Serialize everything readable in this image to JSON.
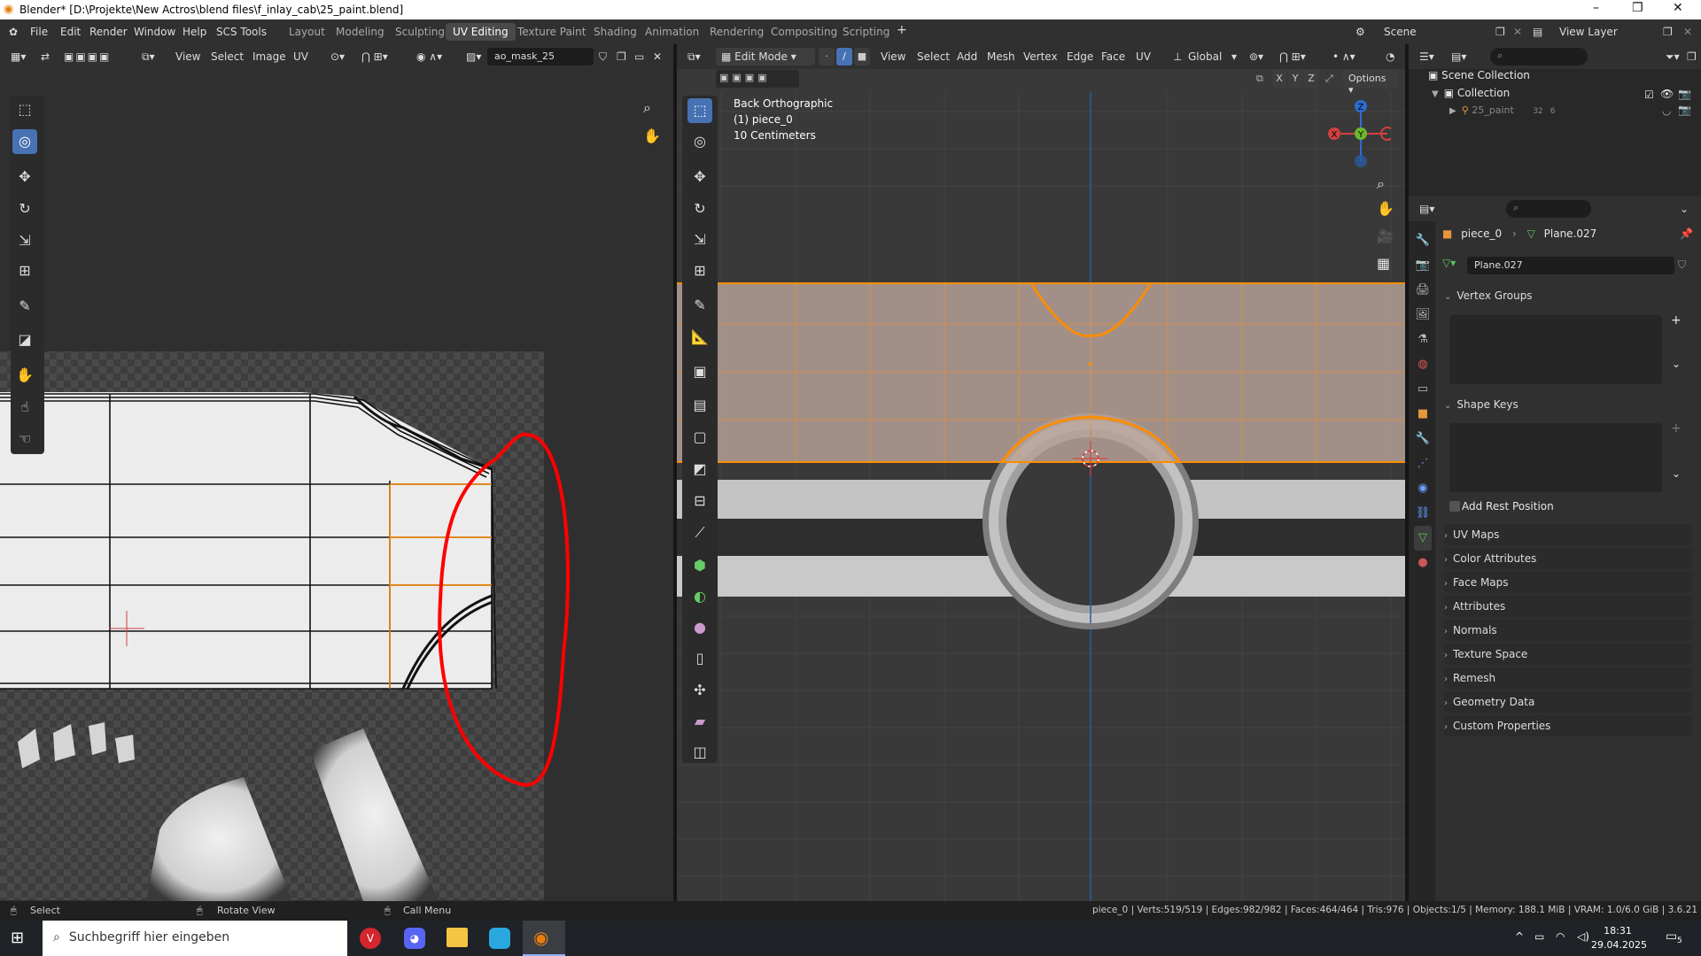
{
  "window": {
    "title": "Blender* [D:\\Projekte\\New Actros\\blend files\\f_inlay_cab\\25_paint.blend]"
  },
  "menu": [
    "File",
    "Edit",
    "Render",
    "Window",
    "Help",
    "SCS Tools"
  ],
  "workspaces": [
    "Layout",
    "Modeling",
    "Sculpting",
    "UV Editing",
    "Texture Paint",
    "Shading",
    "Animation",
    "Rendering",
    "Compositing",
    "Scripting"
  ],
  "active_workspace": "UV Editing",
  "scene": {
    "name": "Scene",
    "view_layer": "View Layer"
  },
  "uv_editor": {
    "menus": [
      "View",
      "Select",
      "Image",
      "UV"
    ],
    "image_name": "ao_mask_25"
  },
  "viewport": {
    "mode": "Edit Mode",
    "menus": [
      "View",
      "Select",
      "Add",
      "Mesh",
      "Vertex",
      "Edge",
      "Face",
      "UV"
    ],
    "orientation": "Global",
    "options_label": "Options",
    "axes": [
      "X",
      "Y",
      "Z"
    ],
    "overlay_lines": [
      "Back Orthographic",
      "(1) piece_0",
      "10 Centimeters"
    ],
    "gizmo": {
      "x": "X",
      "y": "Y",
      "z": "Z"
    }
  },
  "outliner": {
    "scene_collection": "Scene Collection",
    "collection": "Collection",
    "object": "25_paint",
    "object_count": "32",
    "object_count2": "6"
  },
  "properties": {
    "breadcrumb_object": "piece_0",
    "breadcrumb_mesh": "Plane.027",
    "mesh_name": "Plane.027",
    "sections_open": [
      "Vertex Groups",
      "Shape Keys"
    ],
    "add_rest_position": "Add Rest Position",
    "sections_closed": [
      "UV Maps",
      "Color Attributes",
      "Face Maps",
      "Attributes",
      "Normals",
      "Texture Space",
      "Remesh",
      "Geometry Data",
      "Custom Properties"
    ]
  },
  "status": {
    "select": "Select",
    "rotate": "Rotate View",
    "call_menu": "Call Menu",
    "stats": "piece_0 | Verts:519/519 | Edges:982/982 | Faces:464/464 | Tris:976 | Objects:1/5 | Memory: 188.1 MiB | VRAM: 1.0/6.0 GiB | 3.6.21"
  },
  "taskbar": {
    "search_placeholder": "Suchbegriff hier eingeben",
    "time": "18:31",
    "date": "29.04.2025",
    "notifications": "5"
  },
  "colors": {
    "accent": "#4772b3",
    "selection": "#ff8c00",
    "annotation": "#ff0000"
  }
}
